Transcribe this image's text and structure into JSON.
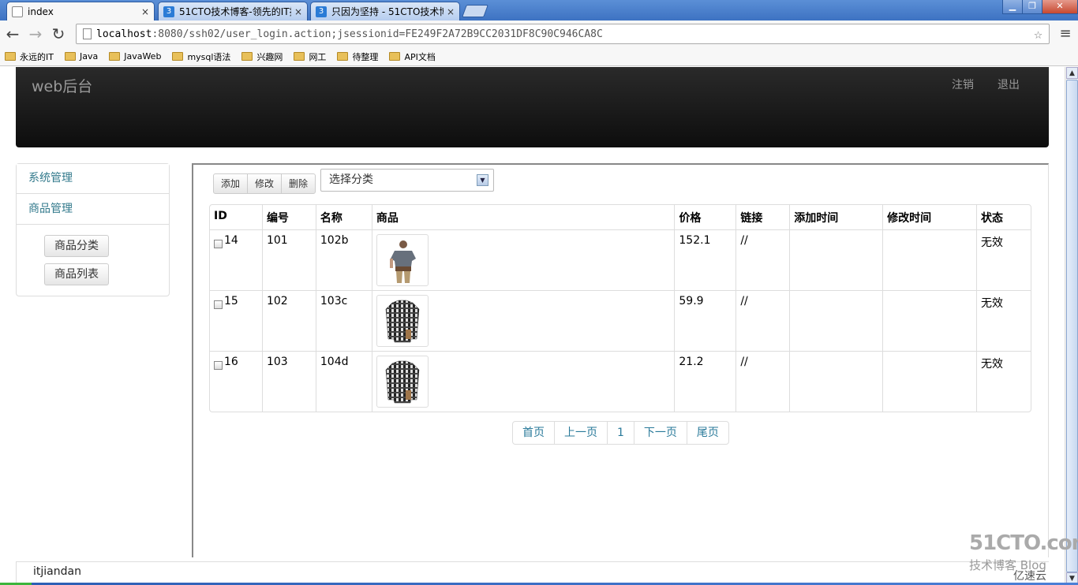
{
  "browser": {
    "tabs": [
      {
        "title": "index",
        "active": true
      },
      {
        "title": "51CTO技术博客-领先的IT技",
        "active": false
      },
      {
        "title": "只因为坚持 - 51CTO技术博",
        "active": false
      }
    ],
    "tab_close": "×",
    "url_host": "localhost",
    "url_rest": ":8080/ssh02/user_login.action;jsessionid=FE249F2A72B9CC2031DF8C90C946CA8C",
    "tab_icon_letter": "3",
    "bookmarks": [
      "永远的IT",
      "Java",
      "JavaWeb",
      "mysql语法",
      "兴趣网",
      "网工",
      "待整理",
      "API文档"
    ],
    "window_buttons": {
      "minimize": "▁",
      "maximize": "❐",
      "close": "✕"
    }
  },
  "navbar": {
    "brand": "web后台",
    "links": [
      "注销",
      "退出"
    ]
  },
  "sidebar": {
    "sections": [
      "系统管理",
      "商品管理"
    ],
    "items": [
      "商品分类",
      "商品列表"
    ]
  },
  "toolbar": {
    "buttons": [
      "添加",
      "修改",
      "删除"
    ],
    "category_select": "选择分类"
  },
  "table": {
    "headers": [
      "ID",
      "编号",
      "名称",
      "商品",
      "价格",
      "链接",
      "添加时间",
      "修改时间",
      "状态"
    ],
    "rows": [
      {
        "id": "14",
        "code": "101",
        "name": "102b",
        "product_icon": "tshirt-photo",
        "price": "152.1",
        "link": "//",
        "added": "",
        "modified": "",
        "status": "无效"
      },
      {
        "id": "15",
        "code": "102",
        "name": "103c",
        "product_icon": "plaid-shirt-photo",
        "price": "59.9",
        "link": "//",
        "added": "",
        "modified": "",
        "status": "无效"
      },
      {
        "id": "16",
        "code": "103",
        "name": "104d",
        "product_icon": "plaid-shirt-photo",
        "price": "21.2",
        "link": "//",
        "added": "",
        "modified": "",
        "status": "无效"
      }
    ]
  },
  "pager": [
    "首页",
    "上一页",
    "1",
    "下一页",
    "尾页"
  ],
  "footer": {
    "text": "itjiandan"
  },
  "watermark": {
    "logo": "51CTO.com",
    "sub": "技术博客 Blog",
    "site": "亿速云"
  },
  "colors": {
    "link": "#2a7a9a",
    "navbar": "#1b1b1b",
    "sidebar_link": "#337a8c"
  }
}
